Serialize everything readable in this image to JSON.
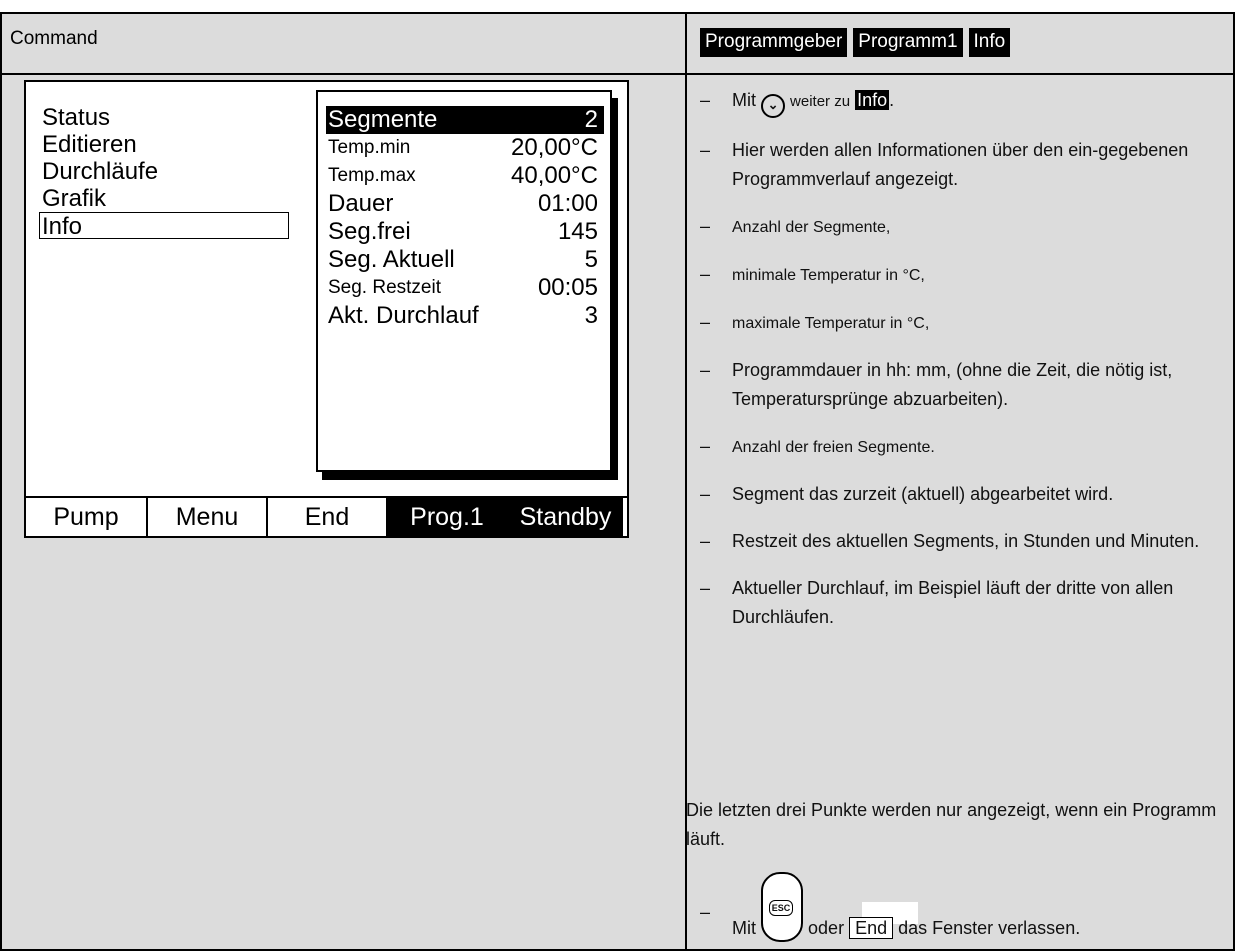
{
  "header": {
    "left": "Command",
    "tags": [
      "Programmgeber",
      "Programm1",
      "Info"
    ]
  },
  "screen": {
    "menu": [
      "Status",
      "Editieren",
      "Durchläufe",
      "Grafik",
      "Info"
    ],
    "selected_menu": "Info",
    "panel": [
      {
        "k": "Segmente",
        "v": "2"
      },
      {
        "k": "Temp.min",
        "v": "20,00°C"
      },
      {
        "k": "Temp.max",
        "v": "40,00°C"
      },
      {
        "k": "Dauer",
        "v": "01:00"
      },
      {
        "k": "Seg.frei",
        "v": "145"
      },
      {
        "k": "Seg. Aktuell",
        "v": "5"
      },
      {
        "k": "Seg. Restzeit",
        "v": "00:05"
      },
      {
        "k": "Akt. Durchlauf",
        "v": "3"
      }
    ],
    "softkeys": [
      "Pump",
      "Menu",
      "End",
      "Prog.1",
      "Standby"
    ]
  },
  "instructions": {
    "l1_pre": "Mit",
    "l1_icon": "down-arrow-key-icon",
    "l1_mid": "weiter zu",
    "l1_tag": "Info",
    "l1_post": ".",
    "items": [
      "Hier werden allen Informationen über den ein-gegebenen Programmverlauf angezeigt.",
      "Anzahl der Segmente,",
      "minimale Temperatur in °C,",
      "maximale Temperatur in °C,",
      "Programmdauer in hh: mm, (ohne die Zeit, die nötig ist, Temperatursprünge abzuarbeiten).",
      "Anzahl der freien Segmente.",
      "Segment das zurzeit (aktuell) abgearbeitet wird.",
      "Restzeit des aktuellen Segments, in Stunden und Minuten.",
      "Aktueller Durchlauf, im Beispiel läuft der dritte von allen Durchläufen."
    ],
    "note": "Die letzten drei Punkte werden nur angezeigt, wenn ein Programm läuft.",
    "last_pre": "Mit",
    "last_key_label": "ESC",
    "last_mid": "oder",
    "last_button": "End",
    "last_post": "das Fenster verlassen."
  },
  "dash": "–"
}
